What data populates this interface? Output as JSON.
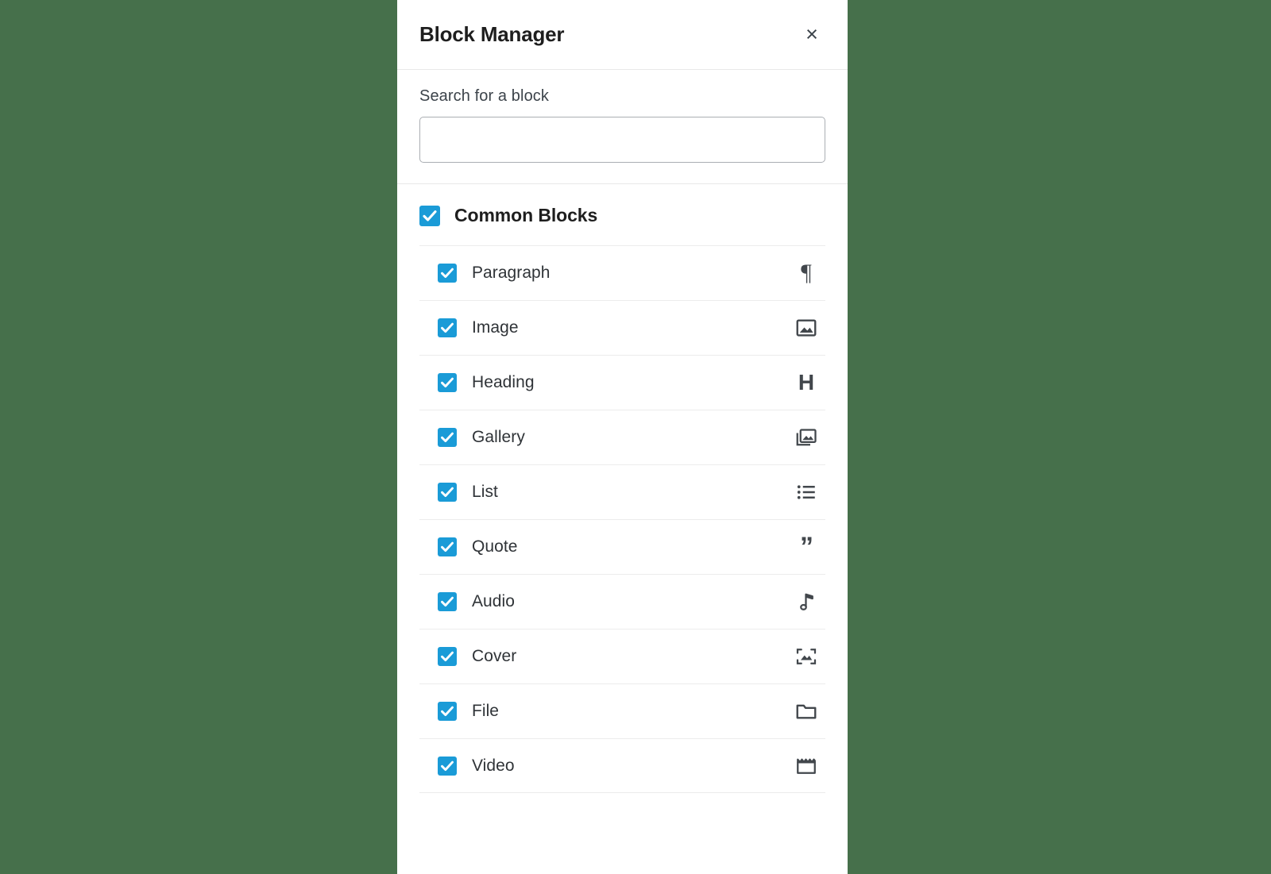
{
  "theme": {
    "backdrop_color": "#46704b",
    "panel_background": "#ffffff",
    "checkbox_color": "#1a9bd7",
    "text_color": "#1e1e1e",
    "divider_color": "#ececec"
  },
  "modal": {
    "title": "Block Manager",
    "close_label": "×"
  },
  "search": {
    "label": "Search for a block",
    "value": "",
    "placeholder": ""
  },
  "category": {
    "title": "Common Blocks",
    "checked": true
  },
  "blocks": [
    {
      "label": "Paragraph",
      "checked": true,
      "icon": "pilcrow-icon"
    },
    {
      "label": "Image",
      "checked": true,
      "icon": "image-icon"
    },
    {
      "label": "Heading",
      "checked": true,
      "icon": "heading-icon"
    },
    {
      "label": "Gallery",
      "checked": true,
      "icon": "gallery-icon"
    },
    {
      "label": "List",
      "checked": true,
      "icon": "list-icon"
    },
    {
      "label": "Quote",
      "checked": true,
      "icon": "quote-icon"
    },
    {
      "label": "Audio",
      "checked": true,
      "icon": "music-note-icon"
    },
    {
      "label": "Cover",
      "checked": true,
      "icon": "cover-image-icon"
    },
    {
      "label": "File",
      "checked": true,
      "icon": "folder-icon"
    },
    {
      "label": "Video",
      "checked": true,
      "icon": "film-clapper-icon"
    }
  ]
}
